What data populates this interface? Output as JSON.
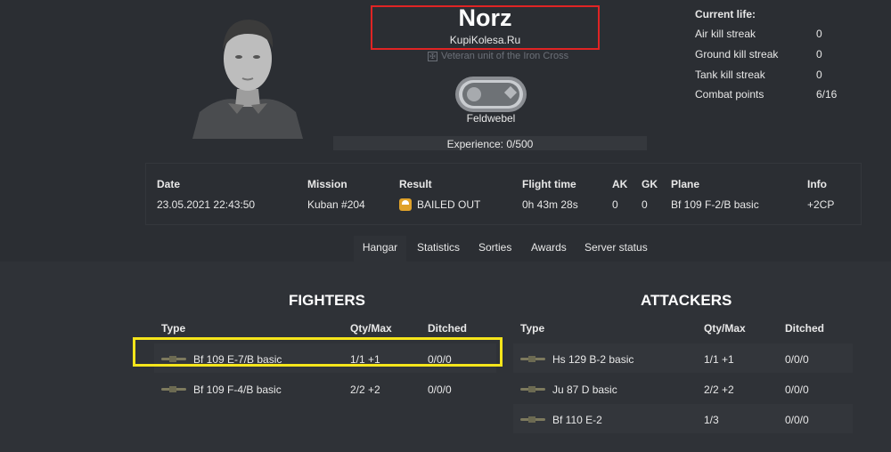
{
  "pilot": {
    "name": "Norz",
    "squad": "KupiKolesa.Ru",
    "unit_badge": "Veteran unit of the Iron Cross",
    "rank": "Feldwebel",
    "experience": "Experience: 0/500"
  },
  "current_life": {
    "title": "Current life:",
    "stats": [
      {
        "label": "Air kill streak",
        "value": "0"
      },
      {
        "label": "Ground kill streak",
        "value": "0"
      },
      {
        "label": "Tank kill streak",
        "value": "0"
      },
      {
        "label": "Combat points",
        "value": "6/16"
      }
    ]
  },
  "last_mission": {
    "headers": {
      "date": "Date",
      "mission": "Mission",
      "result": "Result",
      "flight_time": "Flight time",
      "ak": "AK",
      "gk": "GK",
      "plane": "Plane",
      "info": "Info"
    },
    "row": {
      "date": "23.05.2021 22:43:50",
      "mission": "Kuban #204",
      "result": "BAILED OUT",
      "flight_time": "0h 43m 28s",
      "ak": "0",
      "gk": "0",
      "plane": "Bf 109 F-2/B basic",
      "info": "+2CP"
    }
  },
  "tabs": [
    "Hangar",
    "Statistics",
    "Sorties",
    "Awards",
    "Server status"
  ],
  "hangar": {
    "headers": {
      "type": "Type",
      "qty": "Qty/Max",
      "ditched": "Ditched"
    },
    "fighters": {
      "title": "FIGHTERS",
      "rows": [
        {
          "type": "Bf 109 E-7/B basic",
          "qty": "1/1 +1",
          "ditched": "0/0/0"
        },
        {
          "type": "Bf 109 F-4/B basic",
          "qty": "2/2 +2",
          "ditched": "0/0/0"
        }
      ]
    },
    "attackers": {
      "title": "ATTACKERS",
      "rows": [
        {
          "type": "Hs 129 B-2 basic",
          "qty": "1/1 +1",
          "ditched": "0/0/0"
        },
        {
          "type": "Ju 87 D basic",
          "qty": "2/2 +2",
          "ditched": "0/0/0"
        },
        {
          "type": "Bf 110 E-2",
          "qty": "1/3",
          "ditched": "0/0/0"
        }
      ]
    }
  },
  "colors": {
    "background": "#2d3035",
    "highlight_red": "#e02424",
    "highlight_yellow": "#f5e51b",
    "bailout_icon": "#e0a22a"
  }
}
